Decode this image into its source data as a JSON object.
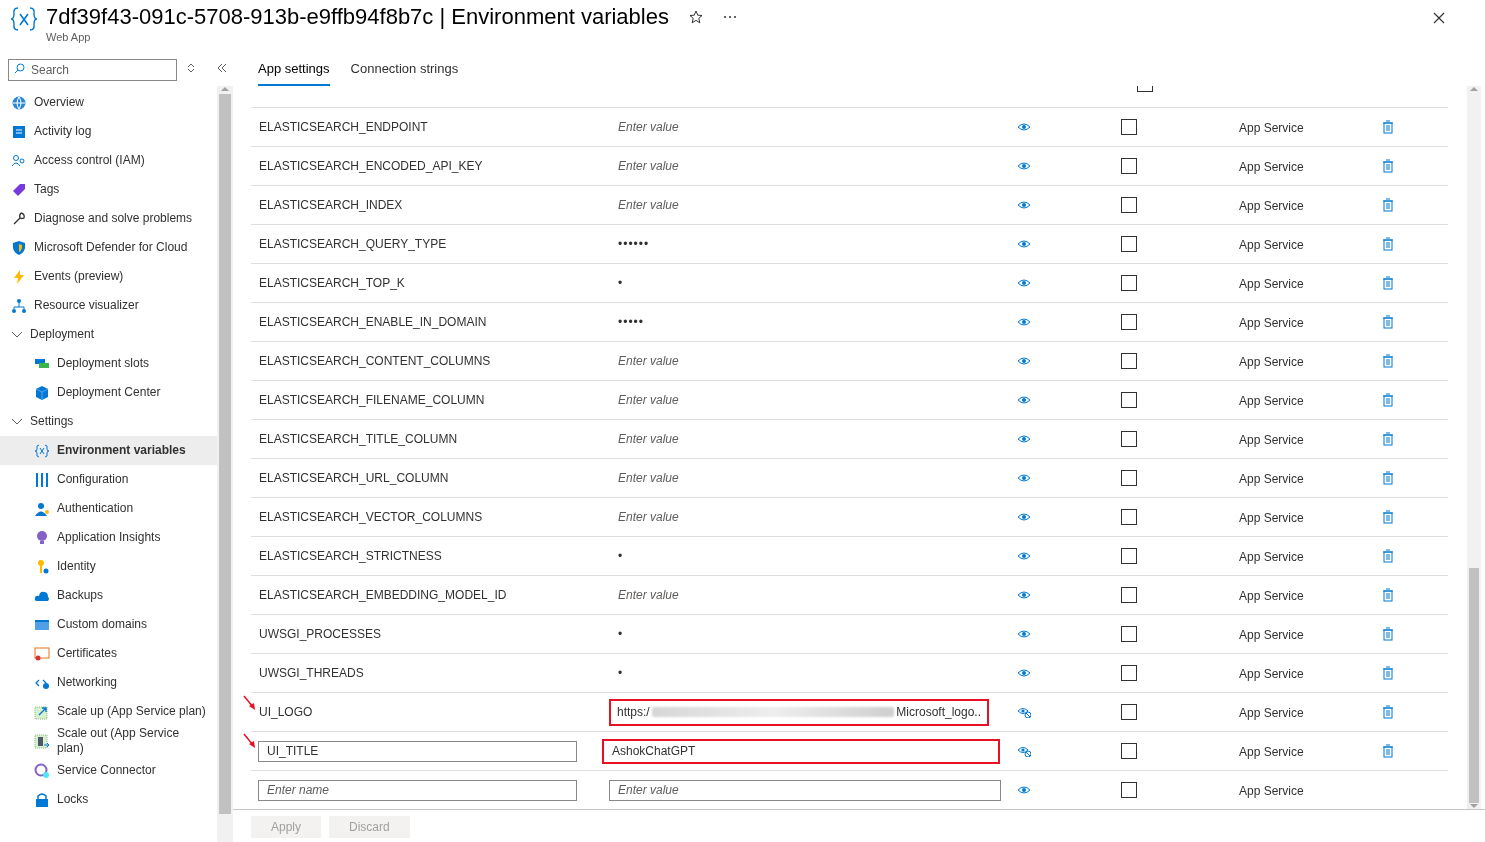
{
  "header": {
    "title": "7df39f43-091c-5708-913b-e9ffb94f8b7c | Environment variables",
    "subtitle": "Web App"
  },
  "sidebar": {
    "search": {
      "placeholder": "Search"
    },
    "items": [
      {
        "label": "Overview",
        "selected": false
      },
      {
        "label": "Activity log",
        "selected": false
      },
      {
        "label": "Access control (IAM)",
        "selected": false
      },
      {
        "label": "Tags",
        "selected": false
      },
      {
        "label": "Diagnose and solve problems",
        "selected": false
      },
      {
        "label": "Microsoft Defender for Cloud",
        "selected": false
      },
      {
        "label": "Events (preview)",
        "selected": false
      },
      {
        "label": "Resource visualizer",
        "selected": false
      },
      {
        "label": "Deployment",
        "expanded": true,
        "selected": false,
        "children": [
          {
            "label": "Deployment slots",
            "selected": false
          },
          {
            "label": "Deployment Center",
            "selected": false
          }
        ]
      },
      {
        "label": "Settings",
        "expanded": true,
        "selected": false,
        "children": [
          {
            "label": "Environment variables",
            "selected": true
          },
          {
            "label": "Configuration",
            "selected": false
          },
          {
            "label": "Authentication",
            "selected": false
          },
          {
            "label": "Application Insights",
            "selected": false
          },
          {
            "label": "Identity",
            "selected": false
          },
          {
            "label": "Backups",
            "selected": false
          },
          {
            "label": "Custom domains",
            "selected": false
          },
          {
            "label": "Certificates",
            "selected": false
          },
          {
            "label": "Networking",
            "selected": false
          },
          {
            "label": "Scale up (App Service plan)",
            "selected": false
          },
          {
            "label": "Scale out (App Service plan)",
            "selected": false
          },
          {
            "label": "Service Connector",
            "selected": false
          },
          {
            "label": "Locks",
            "selected": false
          }
        ]
      }
    ]
  },
  "tabs": [
    {
      "label": "App settings",
      "selected": true
    },
    {
      "label": "Connection strings",
      "selected": false
    }
  ],
  "partial_row": {
    "slot": false
  },
  "settings": [
    {
      "kind": "saved",
      "name": "ELASTICSEARCH_ENDPOINT",
      "placeholder": "Enter value",
      "slot": false,
      "source": "App Service"
    },
    {
      "kind": "saved",
      "name": "ELASTICSEARCH_ENCODED_API_KEY",
      "placeholder": "Enter value",
      "slot": false,
      "source": "App Service"
    },
    {
      "kind": "saved",
      "name": "ELASTICSEARCH_INDEX",
      "placeholder": "Enter value",
      "slot": false,
      "source": "App Service"
    },
    {
      "kind": "saved",
      "name": "ELASTICSEARCH_QUERY_TYPE",
      "value": "••••••",
      "slot": false,
      "source": "App Service"
    },
    {
      "kind": "saved",
      "name": "ELASTICSEARCH_TOP_K",
      "value": "•",
      "slot": false,
      "source": "App Service"
    },
    {
      "kind": "saved",
      "name": "ELASTICSEARCH_ENABLE_IN_DOMAIN",
      "value": "•••••",
      "slot": false,
      "source": "App Service"
    },
    {
      "kind": "saved",
      "name": "ELASTICSEARCH_CONTENT_COLUMNS",
      "placeholder": "Enter value",
      "slot": false,
      "source": "App Service"
    },
    {
      "kind": "saved",
      "name": "ELASTICSEARCH_FILENAME_COLUMN",
      "placeholder": "Enter value",
      "slot": false,
      "source": "App Service"
    },
    {
      "kind": "saved",
      "name": "ELASTICSEARCH_TITLE_COLUMN",
      "placeholder": "Enter value",
      "slot": false,
      "source": "App Service"
    },
    {
      "kind": "saved",
      "name": "ELASTICSEARCH_URL_COLUMN",
      "placeholder": "Enter value",
      "slot": false,
      "source": "App Service"
    },
    {
      "kind": "saved",
      "name": "ELASTICSEARCH_VECTOR_COLUMNS",
      "placeholder": "Enter value",
      "slot": false,
      "source": "App Service"
    },
    {
      "kind": "saved",
      "name": "ELASTICSEARCH_STRICTNESS",
      "value": "•",
      "slot": false,
      "source": "App Service"
    },
    {
      "kind": "saved",
      "name": "ELASTICSEARCH_EMBEDDING_MODEL_ID",
      "placeholder": "Enter value",
      "slot": false,
      "source": "App Service"
    },
    {
      "kind": "saved",
      "name": "UWSGI_PROCESSES",
      "value": "•",
      "slot": false,
      "source": "App Service"
    },
    {
      "kind": "saved",
      "name": "UWSGI_THREADS",
      "value": "•",
      "slot": false,
      "source": "App Service"
    },
    {
      "kind": "value_edited",
      "name": "UI_LOGO",
      "value": "https:/",
      "value_tail": "Microsoft_logo..",
      "shown": true,
      "highlighted": true,
      "slot": false,
      "source": "App Service"
    },
    {
      "kind": "edited",
      "name": "UI_TITLE",
      "value": "AshokChatGPT",
      "shown": true,
      "highlighted": true,
      "slot": false,
      "source": "App Service"
    },
    {
      "kind": "new",
      "name_placeholder": "Enter name",
      "placeholder": "Enter value",
      "slot": false,
      "source": "App Service"
    }
  ],
  "footer": {
    "buttons": [
      {
        "label": "Apply",
        "disabled": true
      },
      {
        "label": "Discard",
        "disabled": true
      }
    ]
  }
}
